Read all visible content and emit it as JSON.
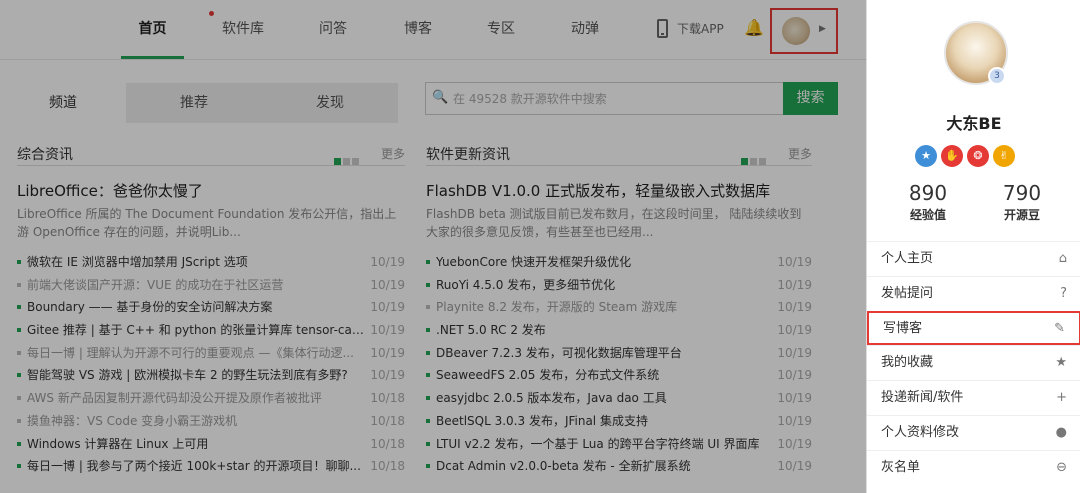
{
  "nav": {
    "items": [
      "首页",
      "软件库",
      "问答",
      "博客",
      "专区",
      "动弹"
    ],
    "download": "下载APP"
  },
  "tabs": [
    "频道",
    "推荐",
    "发现"
  ],
  "search": {
    "placeholder": "在 49528 款开源软件中搜索",
    "button": "搜索"
  },
  "left_col": {
    "title": "综合资讯",
    "more": "更多",
    "feature_title": "LibreOffice：爸爸你太慢了",
    "feature_desc": "LibreOffice 所属的 The Document Foundation 发布公开信，指出上游 OpenOffice 存在的问题，并说明Lib...",
    "items": [
      {
        "text": "微软在 IE 浏览器中增加禁用 JScript 选项",
        "date": "10/19",
        "dim": false
      },
      {
        "text": "前端大佬谈国产开源：VUE 的成功在于社区运营",
        "date": "10/19",
        "dim": true
      },
      {
        "text": "Boundary —— 基于身份的安全访问解决方案",
        "date": "10/19",
        "dim": false
      },
      {
        "text": "Gitee 推荐 | 基于 C++ 和 python 的张量计算库 tensor-calc...",
        "date": "10/19",
        "dim": false
      },
      {
        "text": "每日一博 | 理解认为开源不可行的重要观点 —《集体行动逻...",
        "date": "10/19",
        "dim": true
      },
      {
        "text": "智能驾驶 VS 游戏 | 欧洲模拟卡车 2 的野生玩法到底有多野?",
        "date": "10/19",
        "dim": false
      },
      {
        "text": "AWS 新产品因复制开源代码却没公开提及原作者被批评",
        "date": "10/18",
        "dim": true
      },
      {
        "text": "摸鱼神器：VS Code 变身小霸王游戏机",
        "date": "10/18",
        "dim": true
      },
      {
        "text": "Windows 计算器在 Linux 上可用",
        "date": "10/18",
        "dim": false
      },
      {
        "text": "每日一博 | 我参与了两个接近 100k+star 的开源项目！聊聊...",
        "date": "10/18",
        "dim": false
      }
    ]
  },
  "right_col": {
    "title": "软件更新资讯",
    "more": "更多",
    "feature_title": "FlashDB V1.0.0 正式版发布，轻量级嵌入式数据库",
    "feature_desc": "FlashDB beta 测试版目前已发布数月，在这段时间里， 陆陆续续收到大家的很多意见反馈，有些甚至也已经用...",
    "items": [
      {
        "text": "YuebonCore 快速开发框架升级优化",
        "date": "10/19",
        "dim": false
      },
      {
        "text": "RuoYi 4.5.0 发布，更多细节优化",
        "date": "10/19",
        "dim": false
      },
      {
        "text": "Playnite 8.2 发布，开源版的 Steam 游戏库",
        "date": "10/19",
        "dim": true
      },
      {
        "text": ".NET 5.0 RC 2 发布",
        "date": "10/19",
        "dim": false
      },
      {
        "text": "DBeaver 7.2.3 发布，可视化数据库管理平台",
        "date": "10/19",
        "dim": false
      },
      {
        "text": "SeaweedFS 2.05 发布，分布式文件系统",
        "date": "10/19",
        "dim": false
      },
      {
        "text": "easyjdbc 2.0.5 版本发布，Java dao 工具",
        "date": "10/19",
        "dim": false
      },
      {
        "text": "BeetlSQL 3.0.3 发布，JFinal 集成支持",
        "date": "10/19",
        "dim": false
      },
      {
        "text": "LTUI v2.2 发布，一个基于 Lua 的跨平台字符终端 UI 界面库",
        "date": "10/19",
        "dim": false
      },
      {
        "text": "Dcat Admin v2.0.0-beta 发布 - 全新扩展系统",
        "date": "10/19",
        "dim": false
      }
    ]
  },
  "user": {
    "name": "大东BE",
    "level": "3",
    "exp_value": "890",
    "exp_label": "经验值",
    "bean_value": "790",
    "bean_label": "开源豆",
    "medal_colors": [
      "#3f8fd8",
      "#e53935",
      "#e53935",
      "#f0a500"
    ]
  },
  "menu": [
    {
      "label": "个人主页",
      "icon": "home-icon",
      "glyph": "⌂"
    },
    {
      "label": "发帖提问",
      "icon": "question-icon",
      "glyph": "?"
    },
    {
      "label": "写博客",
      "icon": "edit-icon",
      "glyph": "✎"
    },
    {
      "label": "我的收藏",
      "icon": "star-icon",
      "glyph": "★"
    },
    {
      "label": "投递新闻/软件",
      "icon": "plus-icon",
      "glyph": "+"
    },
    {
      "label": "个人资料修改",
      "icon": "user-icon",
      "glyph": "●"
    },
    {
      "label": "灰名单",
      "icon": "block-icon",
      "glyph": "⊖"
    }
  ],
  "colors": {
    "accent": "#23a455",
    "highlight": "#e53935"
  }
}
